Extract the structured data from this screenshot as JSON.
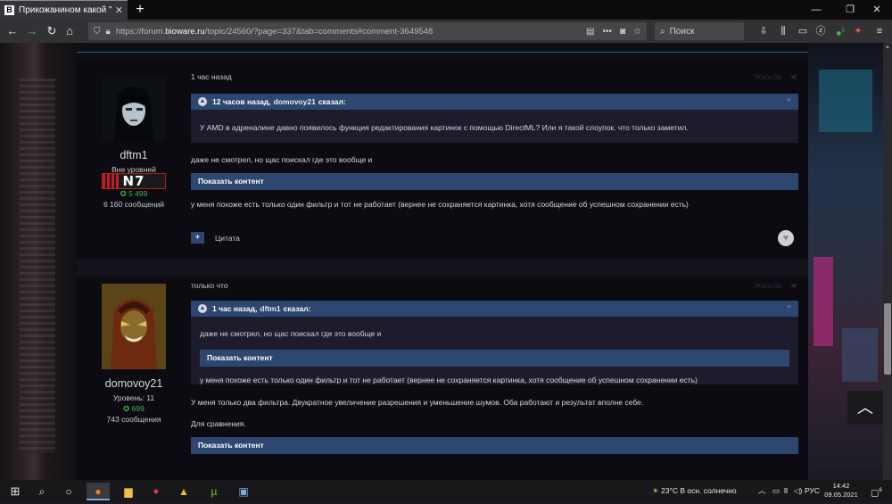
{
  "browser": {
    "tab_title": "Прикожанином какой \"церк",
    "tab_favicon": "B",
    "url_prefix": "https://forum.",
    "url_host": "bioware.ru",
    "url_path": "/topic/24560/?page=337&tab=comments#comment-3649548",
    "search_placeholder": "Поиск",
    "badge_count": "5"
  },
  "post1": {
    "time": "1 час назад",
    "author": {
      "name": "dftm1",
      "rank": "Вне уровней",
      "badge": "N7",
      "reputation": "5 499",
      "posts": "6 160 сообщений"
    },
    "quote": {
      "header_time": "12 часов назад,",
      "header_user": "domovoy21",
      "header_suffix": "сказал:",
      "text": "У AMD в адреналине давно появилось функция редактирования картинок с помощью DirectML? Или я такой слоупок. что только заметил."
    },
    "text1": "даже не смотрел, но щас поискал где это вообще и",
    "spoiler": "Показать контент",
    "text2": "у меня похоже есть только один фильтр и тот не работает (вернее не сохраняется картинка, хотя сообщение об успешном сохранении есть)",
    "quote_button": "Цитата"
  },
  "post2": {
    "time": "только что",
    "author": {
      "name": "domovoy21",
      "rank": "Уровень: 11",
      "reputation": "699",
      "posts": "743 сообщения"
    },
    "quote": {
      "header_time": "1 час назад,",
      "header_user": "dftm1",
      "header_suffix": "сказал:",
      "text1": "даже не смотрел, но щас поискал где это вообще и",
      "spoiler": "Показать контент",
      "text2": "у меня похоже есть только один фильтр и тот не работает (вернее не сохраняется картинка, хотя сообщение об успешном сохранении есть)"
    },
    "text1": "У меня только два фильтра. Двукратное увеличение разрешения и уменьшение шумов. Оба работают и результат вполне себе.",
    "text2": "Для сравнения.",
    "spoiler": "Показать контент"
  },
  "taskbar": {
    "weather": "23°C  В осн. солнечно",
    "lang": "РУС",
    "time": "14:42",
    "date": "09.05.2021",
    "notify_count": "6"
  }
}
